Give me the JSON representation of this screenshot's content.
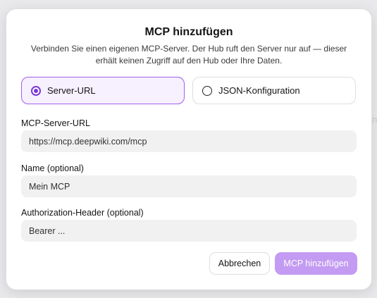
{
  "dialog": {
    "title": "MCP hinzufügen",
    "subtitle": "Verbinden Sie einen eigenen MCP-Server. Der Hub ruft den Server nur auf — dieser erhält keinen Zugriff auf den Hub oder Ihre Daten."
  },
  "mode_options": [
    {
      "label": "Server-URL",
      "selected": true
    },
    {
      "label": "JSON-Konfiguration",
      "selected": false
    }
  ],
  "fields": {
    "server_url": {
      "label": "MCP-Server-URL",
      "value": "https://mcp.deepwiki.com/mcp"
    },
    "name": {
      "label": "Name (optional)",
      "value": "Mein MCP"
    },
    "auth_header": {
      "label": "Authorization-Header (optional)",
      "value": "Bearer ..."
    }
  },
  "buttons": {
    "cancel_label": "Abbrechen",
    "submit_label": "MCP hinzufügen"
  },
  "colors": {
    "accent": "#7a35d8",
    "selected_bg": "#f6f0ff",
    "submit_disabled": "#c39bf2"
  }
}
